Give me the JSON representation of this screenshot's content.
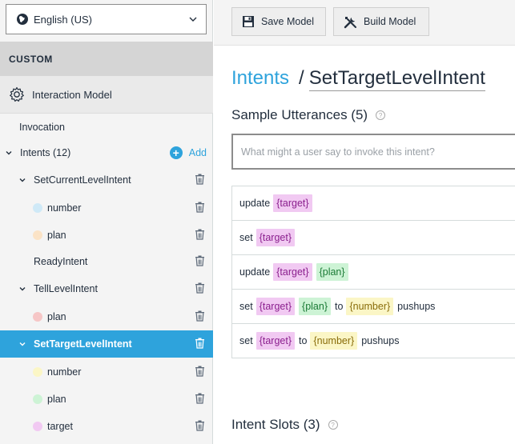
{
  "sidebar": {
    "language": "English (US)",
    "section_label": "CUSTOM",
    "interaction_model_label": "Interaction Model",
    "invocation_label": "Invocation",
    "intents_label": "Intents (12)",
    "add_label": "Add",
    "tree": [
      {
        "label": "SetCurrentLevelIntent",
        "kind": "intent",
        "expanded": true,
        "selected": false
      },
      {
        "label": "number",
        "kind": "slot",
        "dot_color": "#cfe9f7"
      },
      {
        "label": "plan",
        "kind": "slot",
        "dot_color": "#fbe3c6"
      },
      {
        "label": "ReadyIntent",
        "kind": "intent",
        "expanded": false,
        "selected": false
      },
      {
        "label": "TellLevelIntent",
        "kind": "intent",
        "expanded": true,
        "selected": false
      },
      {
        "label": "plan",
        "kind": "slot",
        "dot_color": "#f6c6c6"
      },
      {
        "label": "SetTargetLevelIntent",
        "kind": "intent",
        "expanded": true,
        "selected": true
      },
      {
        "label": "number",
        "kind": "slot",
        "dot_color": "#fbf6c6"
      },
      {
        "label": "plan",
        "kind": "slot",
        "dot_color": "#cdf3d5"
      },
      {
        "label": "target",
        "kind": "slot",
        "dot_color": "#f1c9f2"
      }
    ]
  },
  "toolbar": {
    "save_label": "Save Model",
    "build_label": "Build Model"
  },
  "main": {
    "breadcrumb_root": "Intents",
    "breadcrumb_sep": "/",
    "breadcrumb_current": "SetTargetLevelIntent",
    "utterances_title": "Sample Utterances (5)",
    "utterance_placeholder": "What might a user say to invoke this intent?",
    "slots_title": "Intent Slots (3)",
    "help_glyph": "?"
  },
  "colors": {
    "accent": "#2ea3dc",
    "chip_target": "#f1c9f2",
    "chip_plan": "#cdf3d5",
    "chip_number": "#fbf6c6"
  },
  "utterances": [
    [
      {
        "t": "update"
      },
      {
        "slot": "{target}"
      }
    ],
    [
      {
        "t": "set"
      },
      {
        "slot": "{target}"
      }
    ],
    [
      {
        "t": "update"
      },
      {
        "slot": "{target}"
      },
      {
        "slot": "{plan}"
      }
    ],
    [
      {
        "t": "set"
      },
      {
        "slot": "{target}"
      },
      {
        "slot": "{plan}"
      },
      {
        "t": "to"
      },
      {
        "slot": "{number}"
      },
      {
        "t": "pushups"
      }
    ],
    [
      {
        "t": "set"
      },
      {
        "slot": "{target}"
      },
      {
        "t": "to"
      },
      {
        "slot": "{number}"
      },
      {
        "t": "pushups"
      }
    ]
  ]
}
